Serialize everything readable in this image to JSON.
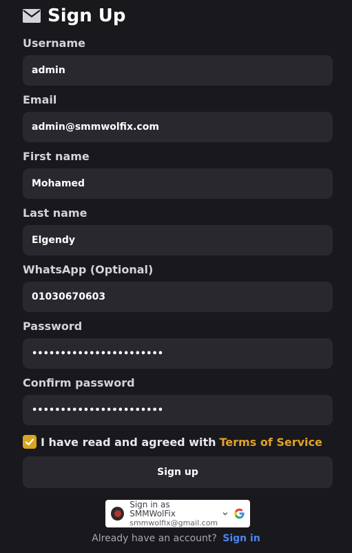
{
  "page": {
    "title": "Sign Up",
    "title_icon": "mail-icon"
  },
  "form": {
    "username": {
      "label": "Username",
      "value": "admin"
    },
    "email": {
      "label": "Email",
      "value": "admin@smmwolfix.com"
    },
    "first_name": {
      "label": "First name",
      "value": "Mohamed"
    },
    "last_name": {
      "label": "Last name",
      "value": "Elgendy"
    },
    "whatsapp": {
      "label": "WhatsApp (Optional)",
      "value": "01030670603"
    },
    "password": {
      "label": "Password",
      "value": "•••••••••••••••••••••••"
    },
    "confirm_password": {
      "label": "Confirm password",
      "value": "•••••••••••••••••••••••"
    }
  },
  "agree": {
    "checked": true,
    "text": "I have read and agreed with",
    "link": "Terms of Service"
  },
  "signup_button": "Sign up",
  "google": {
    "line1": "Sign in as SMMWolFix",
    "line2": "smmwolfix@gmail.com",
    "icon": "google-icon"
  },
  "footer": {
    "text": "Already have an account?",
    "link": "Sign in"
  },
  "colors": {
    "background": "#19181d",
    "field": "#29282e",
    "accent": "#e0a227",
    "link": "#4a86f0"
  }
}
